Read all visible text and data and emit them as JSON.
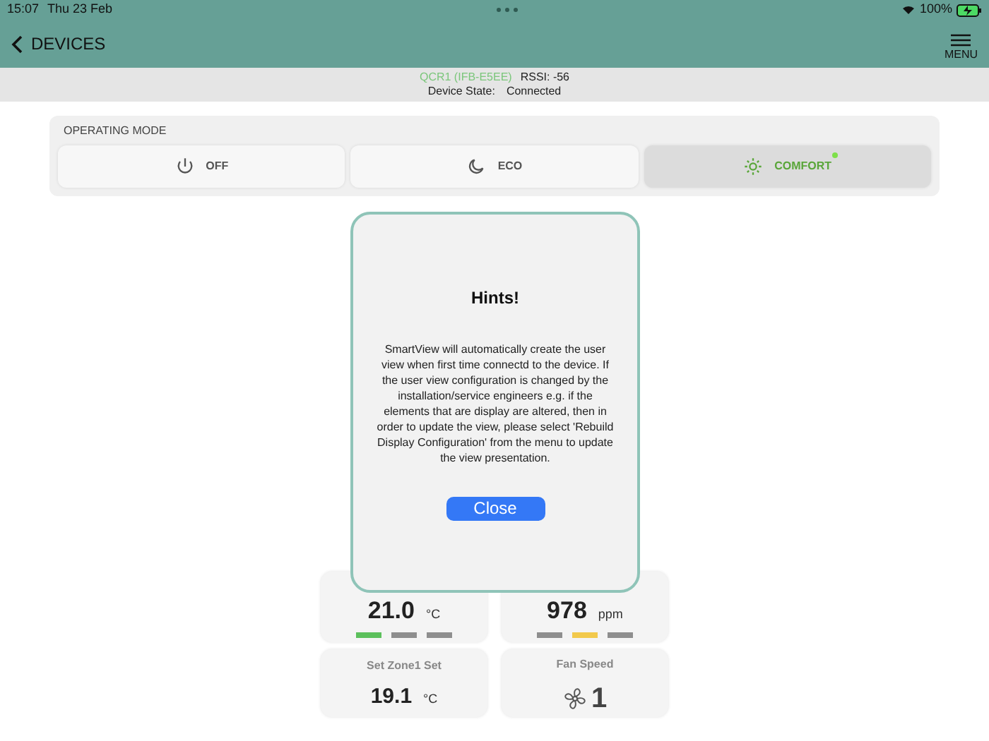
{
  "status_bar": {
    "time": "15:07",
    "date": "Thu 23 Feb",
    "battery": "100%"
  },
  "nav": {
    "back": "DEVICES",
    "menu": "MENU"
  },
  "device": {
    "name": "QCR1 (IFB-E5EE)",
    "rssi": "RSSI: -56",
    "state_label": "Device State:",
    "state": "Connected"
  },
  "operating_mode": {
    "title": "OPERATING MODE",
    "modes": [
      {
        "kind": "power",
        "label": "OFF",
        "selected": false
      },
      {
        "kind": "moon",
        "label": "ECO",
        "selected": false
      },
      {
        "kind": "sun",
        "label": "COMFORT",
        "selected": true
      }
    ]
  },
  "cards": [
    {
      "kind": "reading",
      "value": "21.0",
      "unit": "°C",
      "segments": [
        {
          "color": "#5cc05c"
        },
        {
          "color": "#8e8e8e"
        },
        {
          "color": "#8e8e8e"
        }
      ]
    },
    {
      "kind": "reading",
      "value": "978",
      "unit": "ppm",
      "segments": [
        {
          "color": "#8e8e8e"
        },
        {
          "color": "#f2c94c"
        },
        {
          "color": "#8e8e8e"
        }
      ]
    },
    {
      "kind": "setpoint",
      "title": "Set Zone1 Set",
      "value": "19.1",
      "unit": "°C"
    },
    {
      "kind": "fan",
      "title": "Fan Speed",
      "value": "1"
    }
  ],
  "dialog": {
    "title": "Hints!",
    "message": "SmartView will automatically create the user view when first time connectd to the device. If the user view configuration is changed by the installation/service engineers e.g. if the elements that are display are altered, then in order to update the view, please select 'Rebuild Display Configuration' from the menu to update the view presentation.",
    "button": "Close"
  }
}
